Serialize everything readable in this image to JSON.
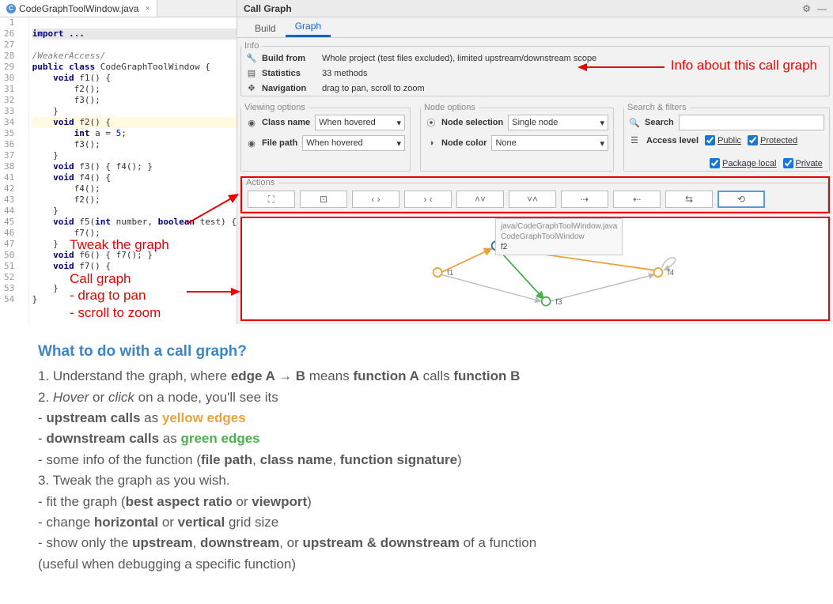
{
  "editor": {
    "tab_name": "CodeGraphToolWindow.java",
    "line_numbers": [
      "1",
      "26",
      "27",
      "28",
      "29",
      "30",
      "31",
      "32",
      "33",
      "34",
      "35",
      "36",
      "37",
      "38",
      "41",
      "42",
      "43",
      "44",
      "45",
      "46",
      "47",
      "50",
      "51",
      "52",
      "53",
      "54"
    ],
    "code_lines": {
      "l1": "import ...",
      "l27": "/WeakerAccess/",
      "l28_a": "public class",
      "l28_b": " CodeGraphToolWindow {",
      "l29_a": "void",
      "l29_b": " f1() {",
      "l30": "f2();",
      "l31": "f3();",
      "l32": "}",
      "l33_a": "void",
      "l33_b": " f2() {",
      "l34_a": "int",
      "l34_b": " a = ",
      "l34_c": "5",
      "l34_d": ";",
      "l35": "f3();",
      "l36": "}",
      "l37_a": "void",
      "l37_b": " f3() { f4(); }",
      "l38_a": "void",
      "l38_b": " f4() {",
      "l41": "f4();",
      "l42": "f2();",
      "l43": "}",
      "l44_a": "void",
      "l44_b": " f5(",
      "l44_c": "int",
      "l44_d": " number, ",
      "l44_e": "boolean",
      "l44_f": " test) {",
      "l45": "f7();",
      "l46": "}",
      "l47_a": "void",
      "l47_b": " f6() { f7(); }",
      "l50_a": "void",
      "l50_b": " f7() {",
      "l52": "}",
      "l53": "}"
    }
  },
  "callgraph": {
    "title": "Call Graph",
    "tabs": {
      "build": "Build",
      "graph": "Graph"
    },
    "info": {
      "legend": "Info",
      "build_from": {
        "label": "Build from",
        "value": "Whole project (test files excluded), limited upstream/downstream scope"
      },
      "statistics": {
        "label": "Statistics",
        "value": "33 methods"
      },
      "navigation": {
        "label": "Navigation",
        "value": "drag to pan, scroll to zoom"
      }
    },
    "viewing": {
      "legend": "Viewing options",
      "class_name": {
        "label": "Class name",
        "value": "When hovered"
      },
      "file_path": {
        "label": "File path",
        "value": "When hovered"
      }
    },
    "node": {
      "legend": "Node options",
      "selection": {
        "label": "Node selection",
        "value": "Single node"
      },
      "color": {
        "label": "Node color",
        "value": "None"
      }
    },
    "search": {
      "legend": "Search & filters",
      "search_label": "Search",
      "access_label": "Access level",
      "public": "Public",
      "protected": "Protected",
      "package": "Package local",
      "private": "Private"
    },
    "actions": {
      "legend": "Actions"
    },
    "tooltip": {
      "line1": "java/CodeGraphToolWindow.java",
      "line2": "CodeGraphToolWindow",
      "line3": "f2"
    },
    "nodes": {
      "f1": "f1",
      "f2": "f2",
      "f3": "f3",
      "f4": "f4"
    }
  },
  "annotations": {
    "info_about": "Info about this call graph",
    "tweak": "Tweak the graph",
    "cg_title": "Call graph",
    "cg_l1": "- drag to pan",
    "cg_l2": "- scroll to zoom"
  },
  "instructions": {
    "title": "What to do with a call graph?",
    "l1a": "1. Understand the graph, where ",
    "l1b": "edge A → B",
    "l1c": " means ",
    "l1d": "function A",
    "l1e": " calls ",
    "l1f": "function B",
    "l2a": "2. ",
    "l2b": "Hover",
    "l2c": " or ",
    "l2d": "click",
    "l2e": " on a node, you'll see its",
    "l3a": "- ",
    "l3b": "upstream calls",
    "l3c": " as ",
    "l3d": "yellow edges",
    "l4a": "- ",
    "l4b": "downstream calls",
    "l4c": " as ",
    "l4d": "green edges",
    "l5a": "- some info of the function (",
    "l5b": "file path",
    "l5c": ", ",
    "l5d": "class name",
    "l5e": ", ",
    "l5f": "function signature",
    "l5g": ")",
    "l6": "3. Tweak the graph as you wish.",
    "l7a": "- fit the graph (",
    "l7b": "best aspect ratio",
    "l7c": " or ",
    "l7d": "viewport",
    "l7e": ")",
    "l8a": "- change ",
    "l8b": "horizontal",
    "l8c": " or ",
    "l8d": "vertical",
    "l8e": " grid size",
    "l9a": "- show only the ",
    "l9b": "upstream",
    "l9c": ", ",
    "l9d": "downstream",
    "l9e": ", or ",
    "l9f": "upstream & downstream",
    "l9g": " of a function",
    "l10": "(useful when debugging a specific function)"
  }
}
